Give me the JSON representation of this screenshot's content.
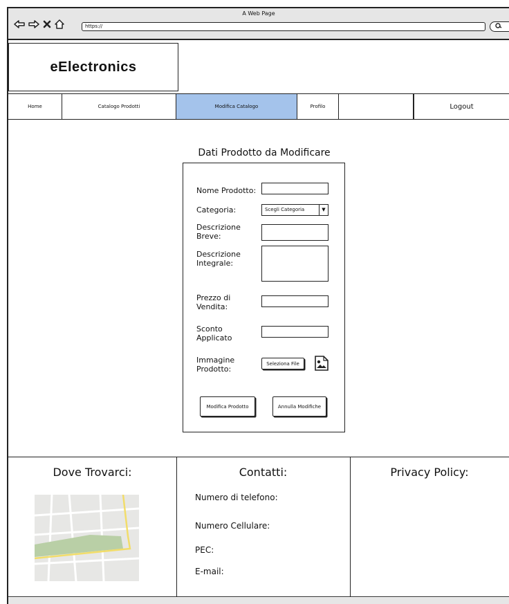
{
  "browser": {
    "window_title": "A Web Page",
    "url": "https://",
    "icons": [
      "back-arrow-icon",
      "forward-arrow-icon",
      "close-x-icon",
      "home-icon",
      "search-icon"
    ]
  },
  "logo": {
    "text": "eElectronics"
  },
  "nav": {
    "items": [
      {
        "label": "Home"
      },
      {
        "label": "Catalogo Prodotti"
      },
      {
        "label": "Modifica Catalogo",
        "active": true
      },
      {
        "label": "Profilo"
      },
      {
        "label": ""
      },
      {
        "label": "Logout"
      }
    ],
    "active_color": "#a4c3eb"
  },
  "form": {
    "title": "Dati Prodotto da Modificare",
    "fields": {
      "nome_label": "Nome Prodotto:",
      "nome_value": "",
      "categoria_label": "Categoria:",
      "categoria_selected": "Scegli Categoria",
      "descrizione_breve_label_1": "Descrizione",
      "descrizione_breve_label_2": "Breve:",
      "descrizione_breve_value": "",
      "descrizione_integrale_label_1": "Descrizione",
      "descrizione_integrale_label_2": "Integrale:",
      "descrizione_integrale_value": "",
      "prezzo_label_1": "Prezzo di",
      "prezzo_label_2": "Vendita:",
      "prezzo_value": "",
      "sconto_label_1": "Sconto",
      "sconto_label_2": "Applicato",
      "sconto_value": "",
      "immagine_label_1": "Immagine",
      "immagine_label_2": "Prodotto:",
      "select_file_label": "Seleziona File"
    },
    "buttons": {
      "submit": "Modifica Prodotto",
      "cancel": "Annulla Modifiche"
    }
  },
  "footer": {
    "location_title": "Dove Trovarci:",
    "contacts_title": "Contatti:",
    "privacy_title": "Privacy Policy:",
    "contacts": {
      "telefono": "Numero di telefono:",
      "cellulare": "Numero Cellulare:",
      "pec": "PEC:",
      "email": "E-mail:"
    }
  }
}
